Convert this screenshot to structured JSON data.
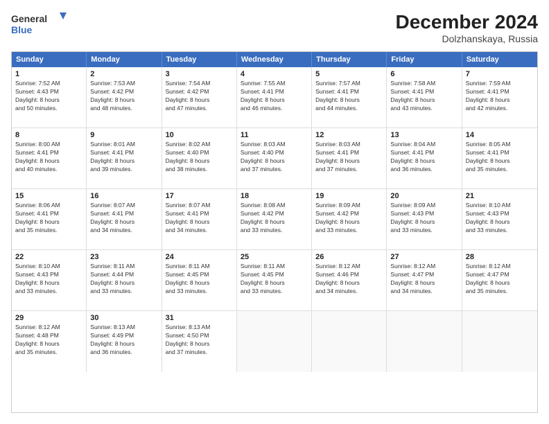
{
  "header": {
    "logo_line1": "General",
    "logo_line2": "Blue",
    "title": "December 2024",
    "subtitle": "Dolzhanskaya, Russia"
  },
  "days": [
    "Sunday",
    "Monday",
    "Tuesday",
    "Wednesday",
    "Thursday",
    "Friday",
    "Saturday"
  ],
  "weeks": [
    [
      {
        "day": "1",
        "info": "Sunrise: 7:52 AM\nSunset: 4:43 PM\nDaylight: 8 hours\nand 50 minutes."
      },
      {
        "day": "2",
        "info": "Sunrise: 7:53 AM\nSunset: 4:42 PM\nDaylight: 8 hours\nand 48 minutes."
      },
      {
        "day": "3",
        "info": "Sunrise: 7:54 AM\nSunset: 4:42 PM\nDaylight: 8 hours\nand 47 minutes."
      },
      {
        "day": "4",
        "info": "Sunrise: 7:55 AM\nSunset: 4:41 PM\nDaylight: 8 hours\nand 46 minutes."
      },
      {
        "day": "5",
        "info": "Sunrise: 7:57 AM\nSunset: 4:41 PM\nDaylight: 8 hours\nand 44 minutes."
      },
      {
        "day": "6",
        "info": "Sunrise: 7:58 AM\nSunset: 4:41 PM\nDaylight: 8 hours\nand 43 minutes."
      },
      {
        "day": "7",
        "info": "Sunrise: 7:59 AM\nSunset: 4:41 PM\nDaylight: 8 hours\nand 42 minutes."
      }
    ],
    [
      {
        "day": "8",
        "info": "Sunrise: 8:00 AM\nSunset: 4:41 PM\nDaylight: 8 hours\nand 40 minutes."
      },
      {
        "day": "9",
        "info": "Sunrise: 8:01 AM\nSunset: 4:41 PM\nDaylight: 8 hours\nand 39 minutes."
      },
      {
        "day": "10",
        "info": "Sunrise: 8:02 AM\nSunset: 4:40 PM\nDaylight: 8 hours\nand 38 minutes."
      },
      {
        "day": "11",
        "info": "Sunrise: 8:03 AM\nSunset: 4:40 PM\nDaylight: 8 hours\nand 37 minutes."
      },
      {
        "day": "12",
        "info": "Sunrise: 8:03 AM\nSunset: 4:41 PM\nDaylight: 8 hours\nand 37 minutes."
      },
      {
        "day": "13",
        "info": "Sunrise: 8:04 AM\nSunset: 4:41 PM\nDaylight: 8 hours\nand 36 minutes."
      },
      {
        "day": "14",
        "info": "Sunrise: 8:05 AM\nSunset: 4:41 PM\nDaylight: 8 hours\nand 35 minutes."
      }
    ],
    [
      {
        "day": "15",
        "info": "Sunrise: 8:06 AM\nSunset: 4:41 PM\nDaylight: 8 hours\nand 35 minutes."
      },
      {
        "day": "16",
        "info": "Sunrise: 8:07 AM\nSunset: 4:41 PM\nDaylight: 8 hours\nand 34 minutes."
      },
      {
        "day": "17",
        "info": "Sunrise: 8:07 AM\nSunset: 4:41 PM\nDaylight: 8 hours\nand 34 minutes."
      },
      {
        "day": "18",
        "info": "Sunrise: 8:08 AM\nSunset: 4:42 PM\nDaylight: 8 hours\nand 33 minutes."
      },
      {
        "day": "19",
        "info": "Sunrise: 8:09 AM\nSunset: 4:42 PM\nDaylight: 8 hours\nand 33 minutes."
      },
      {
        "day": "20",
        "info": "Sunrise: 8:09 AM\nSunset: 4:43 PM\nDaylight: 8 hours\nand 33 minutes."
      },
      {
        "day": "21",
        "info": "Sunrise: 8:10 AM\nSunset: 4:43 PM\nDaylight: 8 hours\nand 33 minutes."
      }
    ],
    [
      {
        "day": "22",
        "info": "Sunrise: 8:10 AM\nSunset: 4:43 PM\nDaylight: 8 hours\nand 33 minutes."
      },
      {
        "day": "23",
        "info": "Sunrise: 8:11 AM\nSunset: 4:44 PM\nDaylight: 8 hours\nand 33 minutes."
      },
      {
        "day": "24",
        "info": "Sunrise: 8:11 AM\nSunset: 4:45 PM\nDaylight: 8 hours\nand 33 minutes."
      },
      {
        "day": "25",
        "info": "Sunrise: 8:11 AM\nSunset: 4:45 PM\nDaylight: 8 hours\nand 33 minutes."
      },
      {
        "day": "26",
        "info": "Sunrise: 8:12 AM\nSunset: 4:46 PM\nDaylight: 8 hours\nand 34 minutes."
      },
      {
        "day": "27",
        "info": "Sunrise: 8:12 AM\nSunset: 4:47 PM\nDaylight: 8 hours\nand 34 minutes."
      },
      {
        "day": "28",
        "info": "Sunrise: 8:12 AM\nSunset: 4:47 PM\nDaylight: 8 hours\nand 35 minutes."
      }
    ],
    [
      {
        "day": "29",
        "info": "Sunrise: 8:12 AM\nSunset: 4:48 PM\nDaylight: 8 hours\nand 35 minutes."
      },
      {
        "day": "30",
        "info": "Sunrise: 8:13 AM\nSunset: 4:49 PM\nDaylight: 8 hours\nand 36 minutes."
      },
      {
        "day": "31",
        "info": "Sunrise: 8:13 AM\nSunset: 4:50 PM\nDaylight: 8 hours\nand 37 minutes."
      },
      {
        "day": "",
        "info": ""
      },
      {
        "day": "",
        "info": ""
      },
      {
        "day": "",
        "info": ""
      },
      {
        "day": "",
        "info": ""
      }
    ]
  ]
}
